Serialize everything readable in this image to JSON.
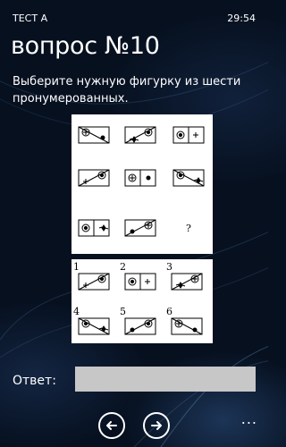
{
  "status": {
    "title": "ТЕСТ А",
    "time": "29:54"
  },
  "heading": "вопрос №10",
  "prompt": "Выберите нужную фигурку из шести пронумерованных.",
  "puzzle": {
    "missing_mark": "?"
  },
  "options": {
    "labels": [
      "1",
      "2",
      "3",
      "4",
      "5",
      "6"
    ]
  },
  "answer": {
    "label": "Ответ:",
    "value": "",
    "placeholder": ""
  },
  "appbar": {
    "back_icon": "arrow-left-icon",
    "forward_icon": "arrow-right-icon",
    "more_label": "..."
  }
}
